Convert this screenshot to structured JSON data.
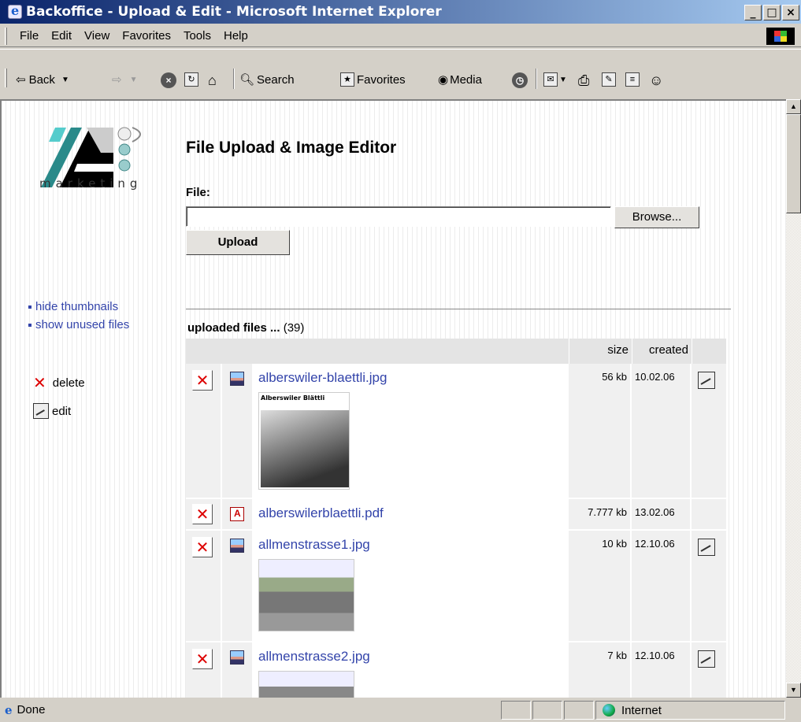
{
  "window": {
    "title": "Backoffice - Upload & Edit - Microsoft Internet Explorer",
    "min": "_",
    "max": "□",
    "close": "×"
  },
  "menu": [
    "File",
    "Edit",
    "View",
    "Favorites",
    "Tools",
    "Help"
  ],
  "toolbar": {
    "back": "Back",
    "search": "Search",
    "favorites": "Favorites",
    "media": "Media"
  },
  "sidebar": {
    "logo_text": "marketing",
    "links": [
      "hide thumbnails",
      "show unused files"
    ],
    "legend_delete": "delete",
    "legend_edit": "edit"
  },
  "main": {
    "heading": "File Upload & Image Editor",
    "file_label": "File:",
    "browse": "Browse...",
    "upload": "Upload",
    "files_title": "uploaded files ...",
    "files_count": "(39)"
  },
  "table": {
    "col_size": "size",
    "col_created": "created",
    "rows": [
      {
        "name": "alberswiler-blaettli.jpg",
        "size": "56 kb",
        "created": "10.02.06",
        "thumb_caption": "Alberswiler Blättli"
      },
      {
        "name": "alberswilerblaettli.pdf",
        "size": "7.777 kb",
        "created": "13.02.06"
      },
      {
        "name": "allmenstrasse1.jpg",
        "size": "10 kb",
        "created": "12.10.06"
      },
      {
        "name": "allmenstrasse2.jpg",
        "size": "7 kb",
        "created": "12.10.06"
      }
    ]
  },
  "status": {
    "done": "Done",
    "zone": "Internet"
  },
  "colors": {
    "link": "#3344aa",
    "delete_red": "#dd0000",
    "titlebar": "#0a246a"
  }
}
